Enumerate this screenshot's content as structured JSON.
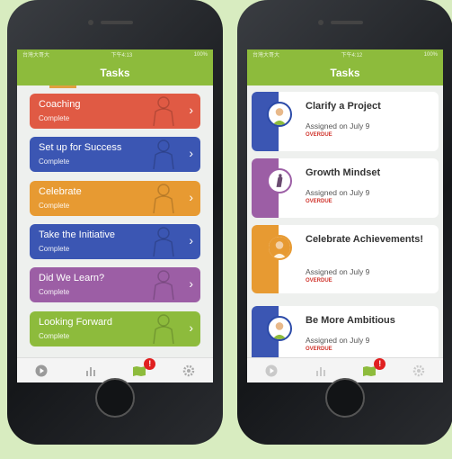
{
  "left_screen": {
    "status": {
      "carrier": "台灣大哥大",
      "time": "下午4:13",
      "battery": "100%"
    },
    "title": "Tasks",
    "tasks": [
      {
        "title": "Coaching",
        "status": "Complete",
        "color": "#e05a44"
      },
      {
        "title": "Set up for Success",
        "status": "Complete",
        "color": "#3b56b3"
      },
      {
        "title": "Celebrate",
        "status": "Complete",
        "color": "#e79a32"
      },
      {
        "title": "Take the Initiative",
        "status": "Complete",
        "color": "#3b56b3"
      },
      {
        "title": "Did We Learn?",
        "status": "Complete",
        "color": "#9c5ea5"
      },
      {
        "title": "Looking Forward",
        "status": "Complete",
        "color": "#8dbb3c"
      }
    ]
  },
  "right_screen": {
    "status": {
      "carrier": "台灣大哥大",
      "time": "下午4:12",
      "battery": "100%"
    },
    "title": "Tasks",
    "cards": [
      {
        "title": "Clarify a Project",
        "assigned": "Assigned on July 9",
        "overdue": "OVERDUE",
        "color": "#3b56b3"
      },
      {
        "title": "Growth Mindset",
        "assigned": "Assigned on July 9",
        "overdue": "OVERDUE",
        "color": "#9c5ea5"
      },
      {
        "title": "Celebrate Achievements!",
        "assigned": "Assigned on July 9",
        "overdue": "OVERDUE",
        "color": "#e79a32"
      },
      {
        "title": "Be More Ambitious",
        "assigned": "Assigned on July 9",
        "overdue": "OVERDUE",
        "color": "#3b56b3"
      }
    ]
  },
  "tabbar": {
    "tabs": [
      "play-icon",
      "bar-chart-icon",
      "map-icon",
      "gear-icon"
    ],
    "badge": "!"
  },
  "colors": {
    "brand_green": "#8dbb3c",
    "overdue_red": "#d0342c",
    "background": "#d8ecc0"
  }
}
